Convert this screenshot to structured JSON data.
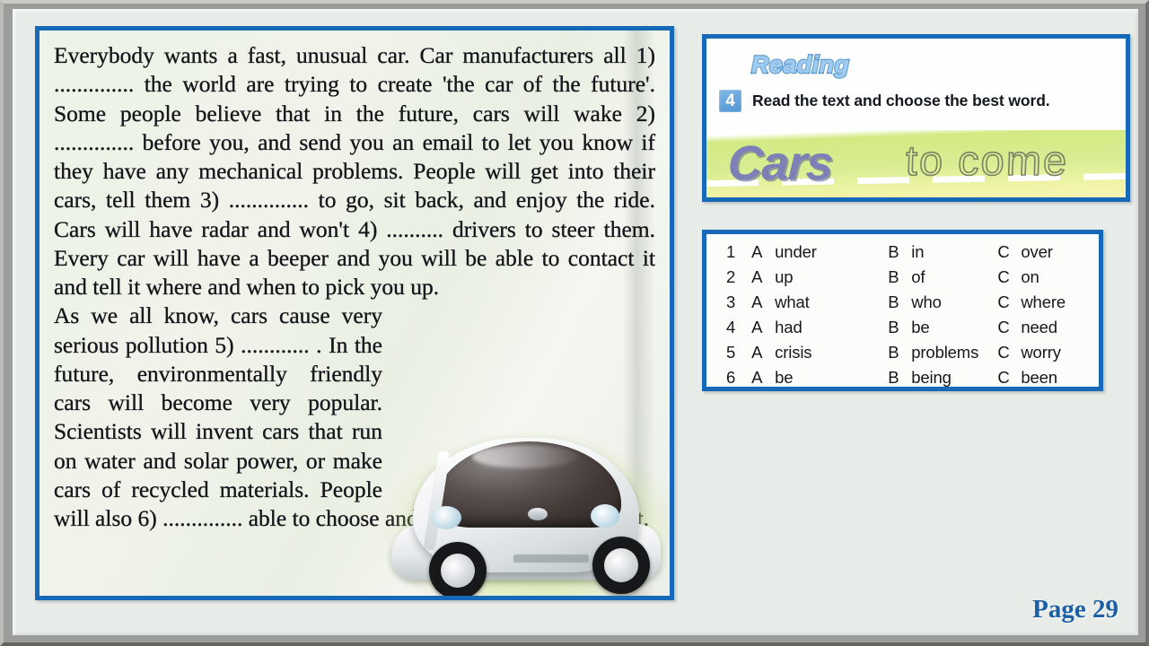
{
  "page": {
    "page_label": "Page 29"
  },
  "passage": {
    "lines": [
      "Everybody wants a fast, unusual car. Car manufacturers all",
      "1) ..............   the world are trying to create 'the car of the",
      "future'. Some people believe that in the future, cars will",
      "wake 2) .............. before you, and send you an email to let",
      "you know if they have any mechanical problems. People",
      "will get into their cars, tell them 3) .............. to go, sit back,",
      "and enjoy the ride. Cars will have radar and won't 4) ..........",
      "drivers to steer them. Every car will have a beeper and you",
      "will be able to contact it and tell it where and when to pick",
      "you up.",
      "As we all know, cars cause very serious pollution",
      "5) ............ . In the future, environmentally friendly cars will",
      "become very popular. Scientists will invent cars that run on water and solar power, or make cars of recycled materials. People will also",
      "6) .............. able to choose and buy cars off the Internet."
    ],
    "paragraph_one": "Everybody wants a fast, unusual car. Car manufacturers all 1) ..............   the world are trying to create 'the car of the future'. Some people believe that in the future, cars will wake 2) .............. before you, and send you an email to let you know if they have any mechanical problems. People will get into their cars, tell them 3) .............. to go, sit back, and enjoy the ride. Cars will have radar and won't 4) .......... drivers to steer them. Every car will have a beeper and you will be able to contact it and tell it where and when to pick you up.",
    "paragraph_two": "As we all know, cars cause very serious pollution 5) ............ . In the future, environmentally friendly cars will become very popular. Scientists will invent cars that run on water and solar power, or make cars of recycled materials. People will also 6) .............. able to choose and buy cars off the Internet."
  },
  "reading": {
    "section_title": "Reading",
    "exercise_number": "4",
    "instruction": "Read the text and choose the best word.",
    "banner_title_main": "Cars",
    "banner_title_rest": "to come"
  },
  "options": {
    "rows": [
      {
        "num": "1",
        "a_letter": "A",
        "a": "under",
        "b_letter": "B",
        "b": "in",
        "c_letter": "C",
        "c": "over"
      },
      {
        "num": "2",
        "a_letter": "A",
        "a": "up",
        "b_letter": "B",
        "b": "of",
        "c_letter": "C",
        "c": "on"
      },
      {
        "num": "3",
        "a_letter": "A",
        "a": "what",
        "b_letter": "B",
        "b": "who",
        "c_letter": "C",
        "c": "where"
      },
      {
        "num": "4",
        "a_letter": "A",
        "a": "had",
        "b_letter": "B",
        "b": "be",
        "c_letter": "C",
        "c": "need"
      },
      {
        "num": "5",
        "a_letter": "A",
        "a": "crisis",
        "b_letter": "B",
        "b": "problems",
        "c_letter": "C",
        "c": "worry"
      },
      {
        "num": "6",
        "a_letter": "A",
        "a": "be",
        "b_letter": "B",
        "b": "being",
        "c_letter": "C",
        "c": "been"
      }
    ]
  },
  "colors": {
    "panel_border_blue": "#1569b6",
    "page_number_blue": "#1c5fa4",
    "reading_title_blue": "#9ecbf0",
    "badge_blue": "#4f95d4",
    "banner_green": "#d3ea83",
    "banner_yellow": "#fbf6c2",
    "cars_purple": "#7c80b6",
    "slide_background": "#e8ece8",
    "frame_gray": "#9a9d99"
  }
}
